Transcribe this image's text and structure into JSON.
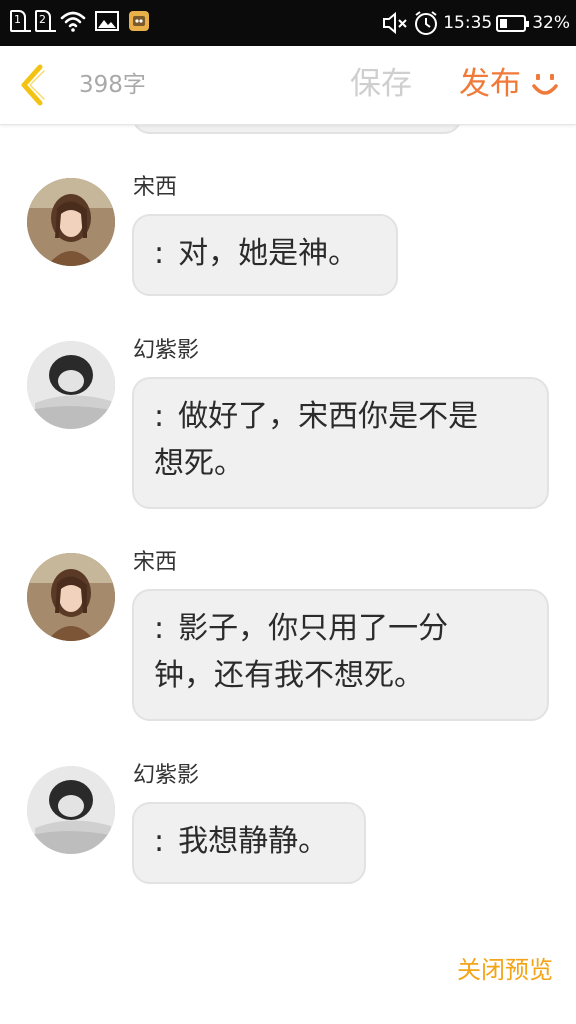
{
  "status_bar": {
    "sim1": "1",
    "sim2": "2",
    "time": "15:35",
    "battery": "32%",
    "battery_level": 0.32,
    "icons": [
      "sim-card-icon",
      "sim-card-icon",
      "wifi-icon",
      "image-icon",
      "app-notification-icon",
      "mute-icon",
      "alarm-icon",
      "battery-icon"
    ]
  },
  "header": {
    "back_icon": "chevron-left-icon",
    "word_count": "398字",
    "save_label": "保存",
    "publish_label": "发布",
    "extra_icon": "smile-icon"
  },
  "messages": [
    {
      "name": "宋西",
      "colon": ":",
      "lines": [
        "对，她是神。"
      ],
      "avatar": "color"
    },
    {
      "name": "幻紫影",
      "colon": ":",
      "lines": [
        "做好了，宋西你是不是",
        "想死。"
      ],
      "avatar": "gray"
    },
    {
      "name": "宋西",
      "colon": ":",
      "lines": [
        "影子，你只用了一分",
        "钟，还有我不想死。"
      ],
      "avatar": "color"
    },
    {
      "name": "幻紫影",
      "colon": ":",
      "lines": [
        "我想静静。"
      ],
      "avatar": "gray"
    }
  ],
  "footer": {
    "close_preview_label": "关闭预览"
  },
  "colors": {
    "accent_publish": "#f07a3a",
    "accent_close": "#f3a417",
    "back_chevron": "#f2c312"
  }
}
